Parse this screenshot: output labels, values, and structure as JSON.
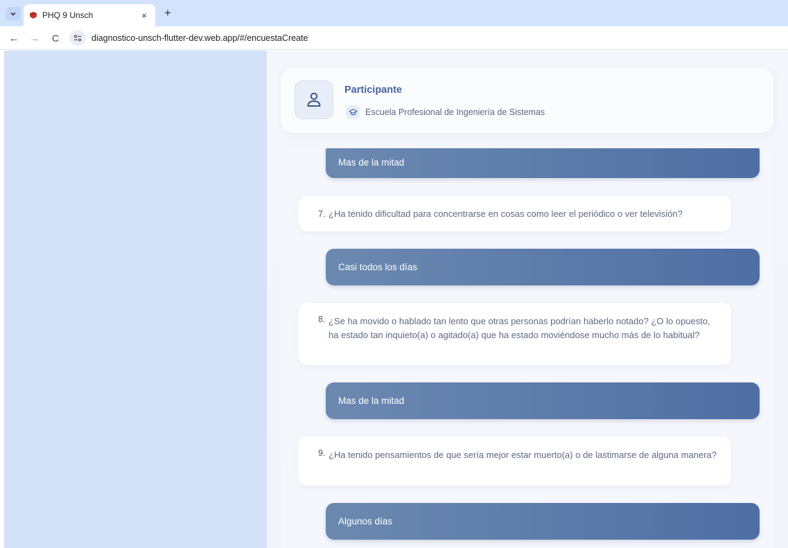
{
  "browser": {
    "tab_title": "PHQ 9 Unsch",
    "tab_close": "×",
    "new_tab": "+",
    "url": "diagnostico-unsch-flutter-dev.web.app/#/encuestaCreate",
    "back": "←",
    "forward": "→",
    "reload": "C"
  },
  "participant": {
    "title": "Participante",
    "school": "Escuela Profesional de Ingeniería de Sistemas",
    "icon": "person-icon",
    "school_icon": "graduation-cap-icon"
  },
  "survey": {
    "items": [
      {
        "answer": "Mas de la mitad"
      },
      {
        "number": "7.",
        "question": "¿Ha tenido dificultad para concentrarse en cosas como leer el periódico o ver televisión?",
        "answer": "Casi todos los días"
      },
      {
        "number": "8.",
        "question": "¿Se ha movido o hablado tan lento que otras personas podrían haberlo notado? ¿O lo opuesto, ha estado tan inquieto(a) o agitado(a) que ha estado moviéndose mucho más de lo habitual?",
        "answer": "Mas de la mitad"
      },
      {
        "number": "9.",
        "question": "¿Ha tenido pensamientos de que sería mejor estar muerto(a) o de lastimarse de alguna manera?",
        "answer": "Algunos días"
      }
    ]
  },
  "colors": {
    "accent": "#4664a0",
    "answer_gradient_start": "#6b89b0",
    "answer_gradient_end": "#4f6fa4",
    "left_panel": "#d3e2f7"
  }
}
